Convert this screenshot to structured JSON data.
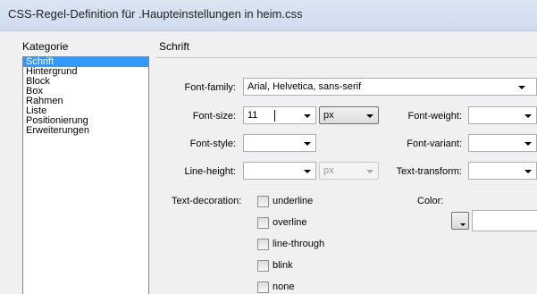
{
  "window": {
    "title": "CSS-Regel-Definition für .Haupteinstellungen in heim.css"
  },
  "category": {
    "heading": "Kategorie",
    "items": [
      "Schrift",
      "Hintergrund",
      "Block",
      "Box",
      "Rahmen",
      "Liste",
      "Positionierung",
      "Erweiterungen"
    ],
    "selected": "Schrift"
  },
  "panel": {
    "heading": "Schrift"
  },
  "font_family": {
    "label": "Font-family:",
    "value": "Arial, Helvetica, sans-serif"
  },
  "font_size": {
    "label": "Font-size:",
    "value": "11",
    "unit": "px"
  },
  "font_weight": {
    "label": "Font-weight:",
    "value": ""
  },
  "font_style": {
    "label": "Font-style:",
    "value": ""
  },
  "font_variant": {
    "label": "Font-variant:",
    "value": ""
  },
  "line_height": {
    "label": "Line-height:",
    "value": "",
    "unit": "px"
  },
  "text_transform": {
    "label": "Text-transform:",
    "value": ""
  },
  "color": {
    "label": "Color:",
    "value": ""
  },
  "text_decoration": {
    "label": "Text-decoration:",
    "options": [
      "underline",
      "overline",
      "line-through",
      "blink",
      "none"
    ]
  }
}
